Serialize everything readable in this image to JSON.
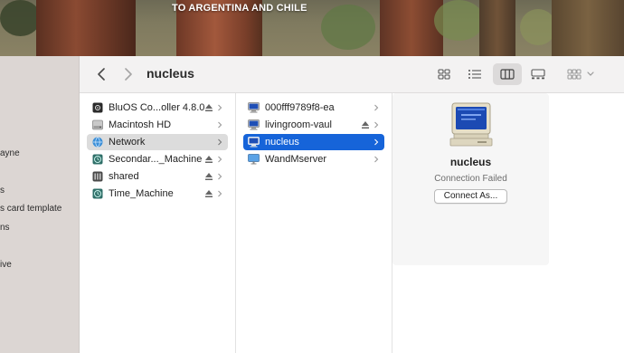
{
  "wallpaper": {
    "caption": "TO ARGENTINA AND CHILE"
  },
  "sidebar": {
    "items": [
      {
        "label": "ayne"
      },
      {
        "label": "s"
      },
      {
        "label": "s card template"
      },
      {
        "label": "ns"
      },
      {
        "label": "ive"
      }
    ]
  },
  "toolbar": {
    "back_icon": "chevron-left-icon",
    "forward_icon": "chevron-right-icon",
    "path_title": "nucleus",
    "views": [
      "icon-view",
      "list-view",
      "column-view",
      "gallery-view",
      "group-menu"
    ],
    "active_view": "column-view"
  },
  "column1": {
    "items": [
      {
        "label": "BluOS Co...oller 4.8.0",
        "icon": "disk-image-icon",
        "eject": true,
        "selected": false
      },
      {
        "label": "Macintosh HD",
        "icon": "hard-drive-icon",
        "eject": false,
        "selected": false
      },
      {
        "label": "Network",
        "icon": "globe-icon",
        "eject": false,
        "selected": true
      },
      {
        "label": "Secondar..._Machine",
        "icon": "time-machine-icon",
        "eject": true,
        "selected": false
      },
      {
        "label": "shared",
        "icon": "server-disk-icon",
        "eject": true,
        "selected": false
      },
      {
        "label": "Time_Machine",
        "icon": "time-machine-icon",
        "eject": true,
        "selected": false
      }
    ]
  },
  "column2": {
    "items": [
      {
        "label": "000fff9789f8-ea",
        "icon": "computer-icon",
        "eject": false,
        "selected": false
      },
      {
        "label": "livingroom-vaul",
        "icon": "computer-icon",
        "eject": true,
        "selected": false
      },
      {
        "label": "nucleus",
        "icon": "computer-icon",
        "eject": false,
        "selected": true
      },
      {
        "label": "WandMserver",
        "icon": "monitor-icon",
        "eject": false,
        "selected": false
      }
    ]
  },
  "preview": {
    "icon": "crt-computer-icon",
    "name": "nucleus",
    "status": "Connection Failed",
    "connect_label": "Connect As..."
  },
  "colors": {
    "selection_blue": "#1664d9",
    "selection_grey": "#dcdcdc"
  }
}
